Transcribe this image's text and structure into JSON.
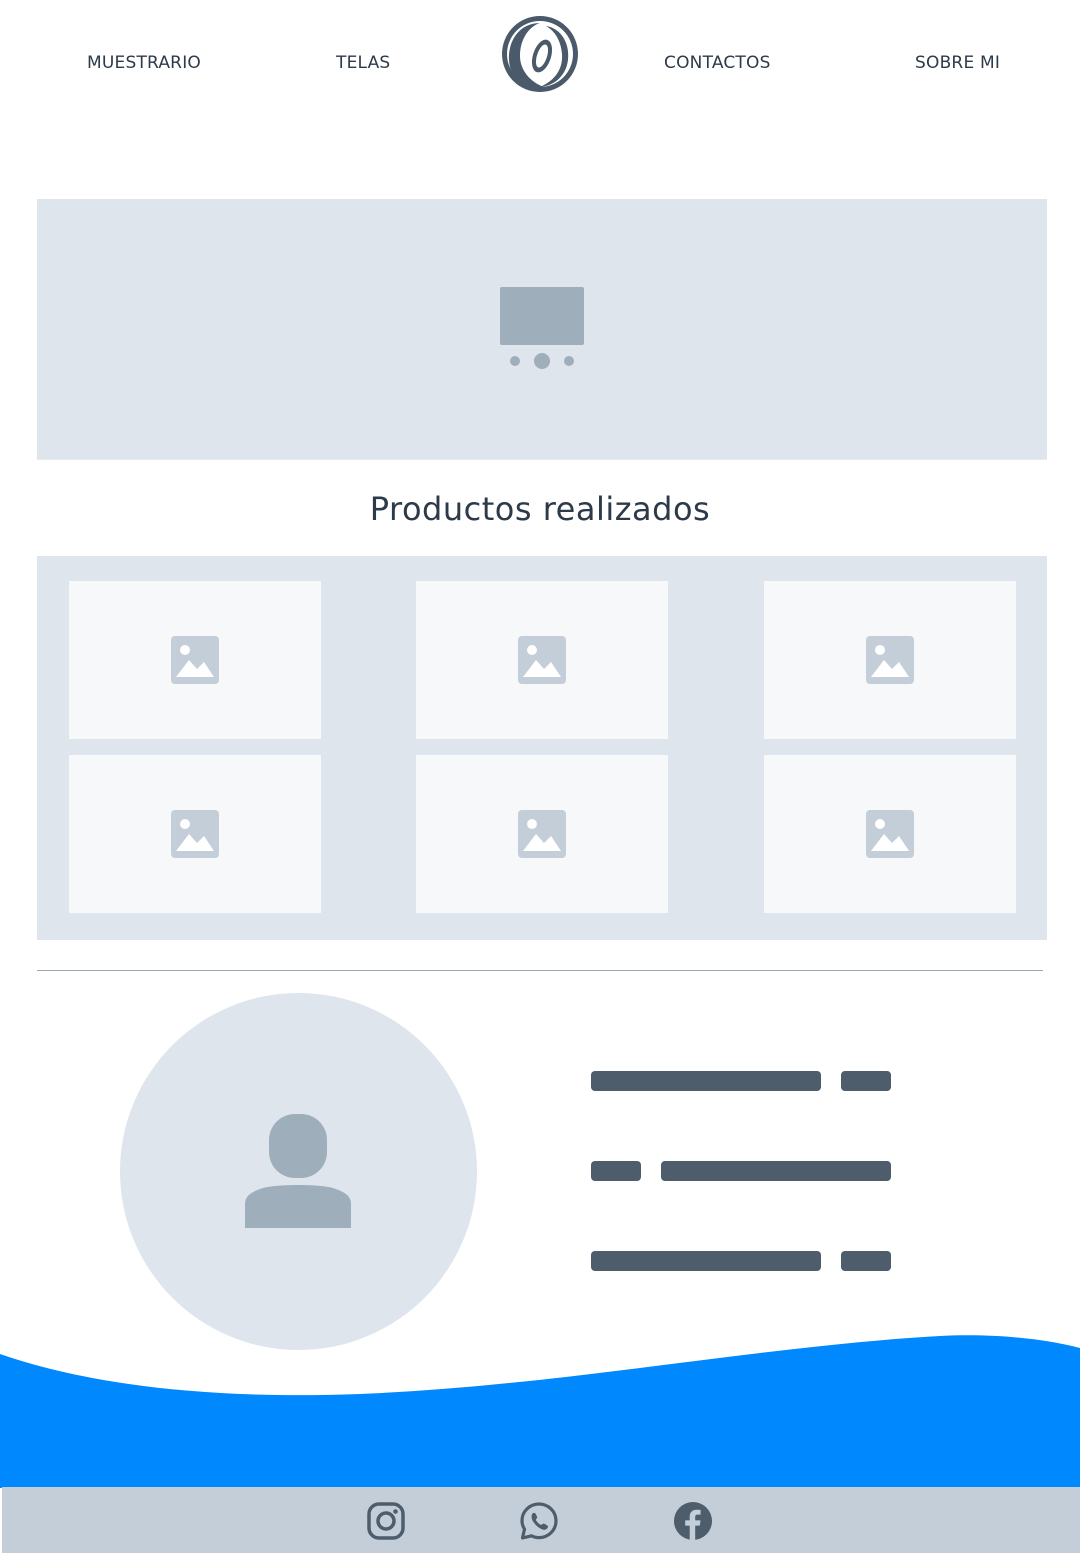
{
  "nav": {
    "items": [
      {
        "label": "MUESTRARIO"
      },
      {
        "label": "TELAS"
      },
      {
        "label": "CONTACTOS"
      },
      {
        "label": "SOBRE MI"
      }
    ]
  },
  "hero": {
    "icon": "slideshow-icon"
  },
  "products": {
    "title": "Productos realizados",
    "items": [
      "image-icon",
      "image-icon",
      "image-icon",
      "image-icon",
      "image-icon",
      "image-icon"
    ]
  },
  "profile": {
    "icon": "user-icon"
  },
  "footer": {
    "social": [
      {
        "icon": "instagram-icon"
      },
      {
        "icon": "whatsapp-icon"
      },
      {
        "icon": "facebook-icon"
      }
    ]
  },
  "colors": {
    "accent": "#0088ff",
    "placeholder_bg": "#dfe5ed",
    "placeholder_icon": "#9faebb",
    "text_dark": "#2d3a4a",
    "footer_bg": "#c4ced8"
  }
}
